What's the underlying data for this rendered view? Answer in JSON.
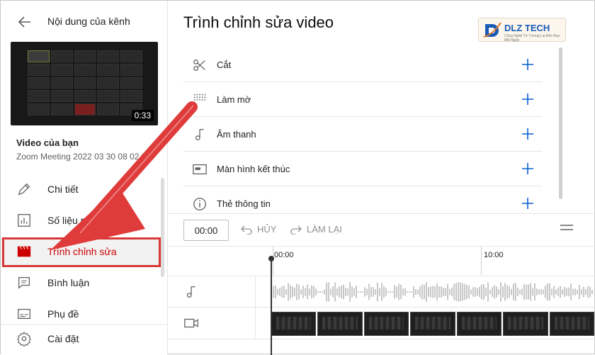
{
  "sidebar": {
    "title": "Nội dung của kênh",
    "thumbnail": {
      "duration": "0:33"
    },
    "your_video_label": "Video của bạn",
    "video_name": "Zoom Meeting 2022 03 30 08 02 27",
    "items": [
      {
        "label": "Chi tiết",
        "icon": "pencil-icon"
      },
      {
        "label": "Số liệu phân tích",
        "icon": "analytics-icon"
      },
      {
        "label": "Trình chỉnh sửa",
        "icon": "editor-clapper-icon",
        "active": true
      },
      {
        "label": "Bình luận",
        "icon": "comment-icon"
      },
      {
        "label": "Phụ đề",
        "icon": "subtitles-icon"
      }
    ],
    "settings_label": "Cài đặt"
  },
  "main": {
    "title": "Trình chỉnh sửa video",
    "logo": {
      "brand": "DLZ TECH",
      "tagline": "Công Nghệ Từ Tương Lai Đến Bạn Mỗi Ngày"
    },
    "tools": [
      {
        "label": "Cắt",
        "icon": "scissors-icon"
      },
      {
        "label": "Làm mờ",
        "icon": "blur-icon"
      },
      {
        "label": "Âm thanh",
        "icon": "music-note-icon"
      },
      {
        "label": "Màn hình kết thúc",
        "icon": "end-screen-icon"
      },
      {
        "label": "Thẻ thông tin",
        "icon": "info-icon"
      }
    ],
    "timeline": {
      "current_time": "00:00",
      "undo_label": "HỦY",
      "redo_label": "LÀM LẠI",
      "ticks": [
        "00:00",
        "10:00"
      ]
    }
  },
  "colors": {
    "accent": "#cc0000",
    "annotation": "#d93838"
  }
}
